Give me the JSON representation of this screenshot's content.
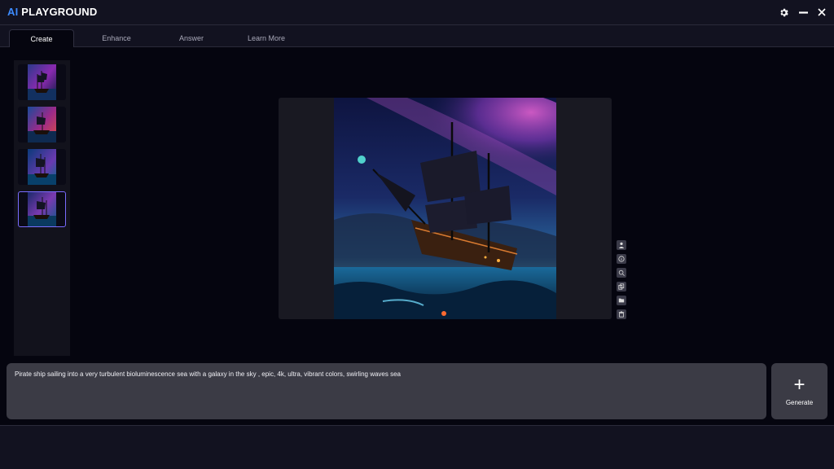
{
  "app": {
    "title_prefix": "AI",
    "title_rest": " PLAYGROUND",
    "accent_color": "#3d8bff"
  },
  "window_controls": {
    "settings_icon": "gear-icon",
    "minimize_icon": "minimize-icon",
    "close_icon": "close-icon"
  },
  "tabs": [
    {
      "label": "Create",
      "active": true
    },
    {
      "label": "Enhance",
      "active": false
    },
    {
      "label": "Answer",
      "active": false
    },
    {
      "label": "Learn More",
      "active": false
    }
  ],
  "thumbnails": {
    "count": 4,
    "selected_index": 3
  },
  "side_tools": [
    {
      "icon": "person-icon"
    },
    {
      "icon": "info-icon"
    },
    {
      "icon": "zoom-icon"
    },
    {
      "icon": "copy-icon"
    },
    {
      "icon": "folder-icon"
    },
    {
      "icon": "trash-icon"
    }
  ],
  "prompt": {
    "value": "Pirate ship sailing into a very turbulent bioluminescence sea with a galaxy in the sky , epic, 4k, ultra, vibrant colors, swirling waves sea"
  },
  "generate": {
    "label": "Generate",
    "icon": "plus-icon"
  }
}
